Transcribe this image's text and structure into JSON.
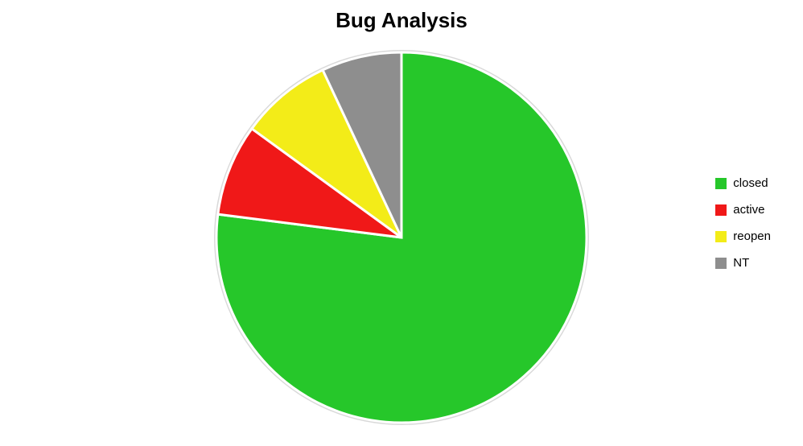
{
  "chart_data": {
    "type": "pie",
    "title": "Bug Analysis",
    "series": [
      {
        "name": "closed",
        "value": 77,
        "color": "#26c72a"
      },
      {
        "name": "active",
        "value": 8,
        "color": "#f01818"
      },
      {
        "name": "reopen",
        "value": 8,
        "color": "#f3ec18"
      },
      {
        "name": "NT",
        "value": 7,
        "color": "#8e8e8e"
      }
    ]
  }
}
